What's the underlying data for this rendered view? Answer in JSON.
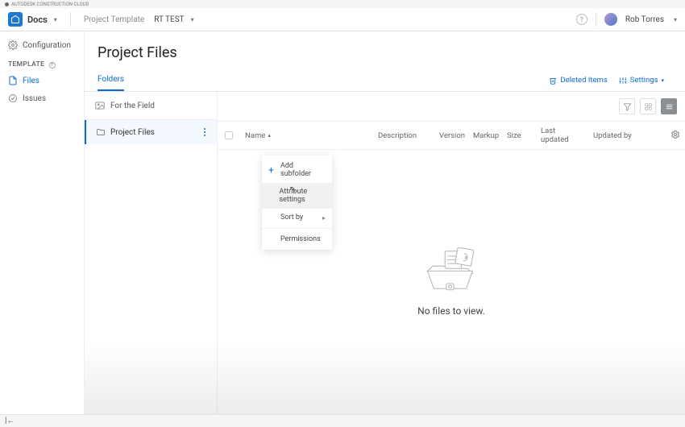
{
  "top_brand": "AUTODESK CONSTRUCTION CLOUD",
  "header": {
    "app_name": "Docs",
    "template_label": "Project Template",
    "template_name": "RT TEST",
    "user_name": "Rob Torres"
  },
  "sidebar": {
    "configuration": "Configuration",
    "section_label": "TEMPLATE",
    "files": "Files",
    "issues": "Issues"
  },
  "page": {
    "title": "Project Files",
    "tab": "Folders",
    "deleted_items": "Deleted Items",
    "settings": "Settings"
  },
  "folders": {
    "top": "For the Field",
    "selected": "Project Files"
  },
  "columns": {
    "name": "Name",
    "description": "Description",
    "version": "Version",
    "markup": "Markup",
    "size": "Size",
    "last_updated": "Last updated",
    "updated_by": "Updated by"
  },
  "empty_message": "No files to view.",
  "context_menu": {
    "add_subfolder": "Add subfolder",
    "attribute_settings": "Attribute settings",
    "sort_by": "Sort by",
    "permissions": "Permissions"
  }
}
